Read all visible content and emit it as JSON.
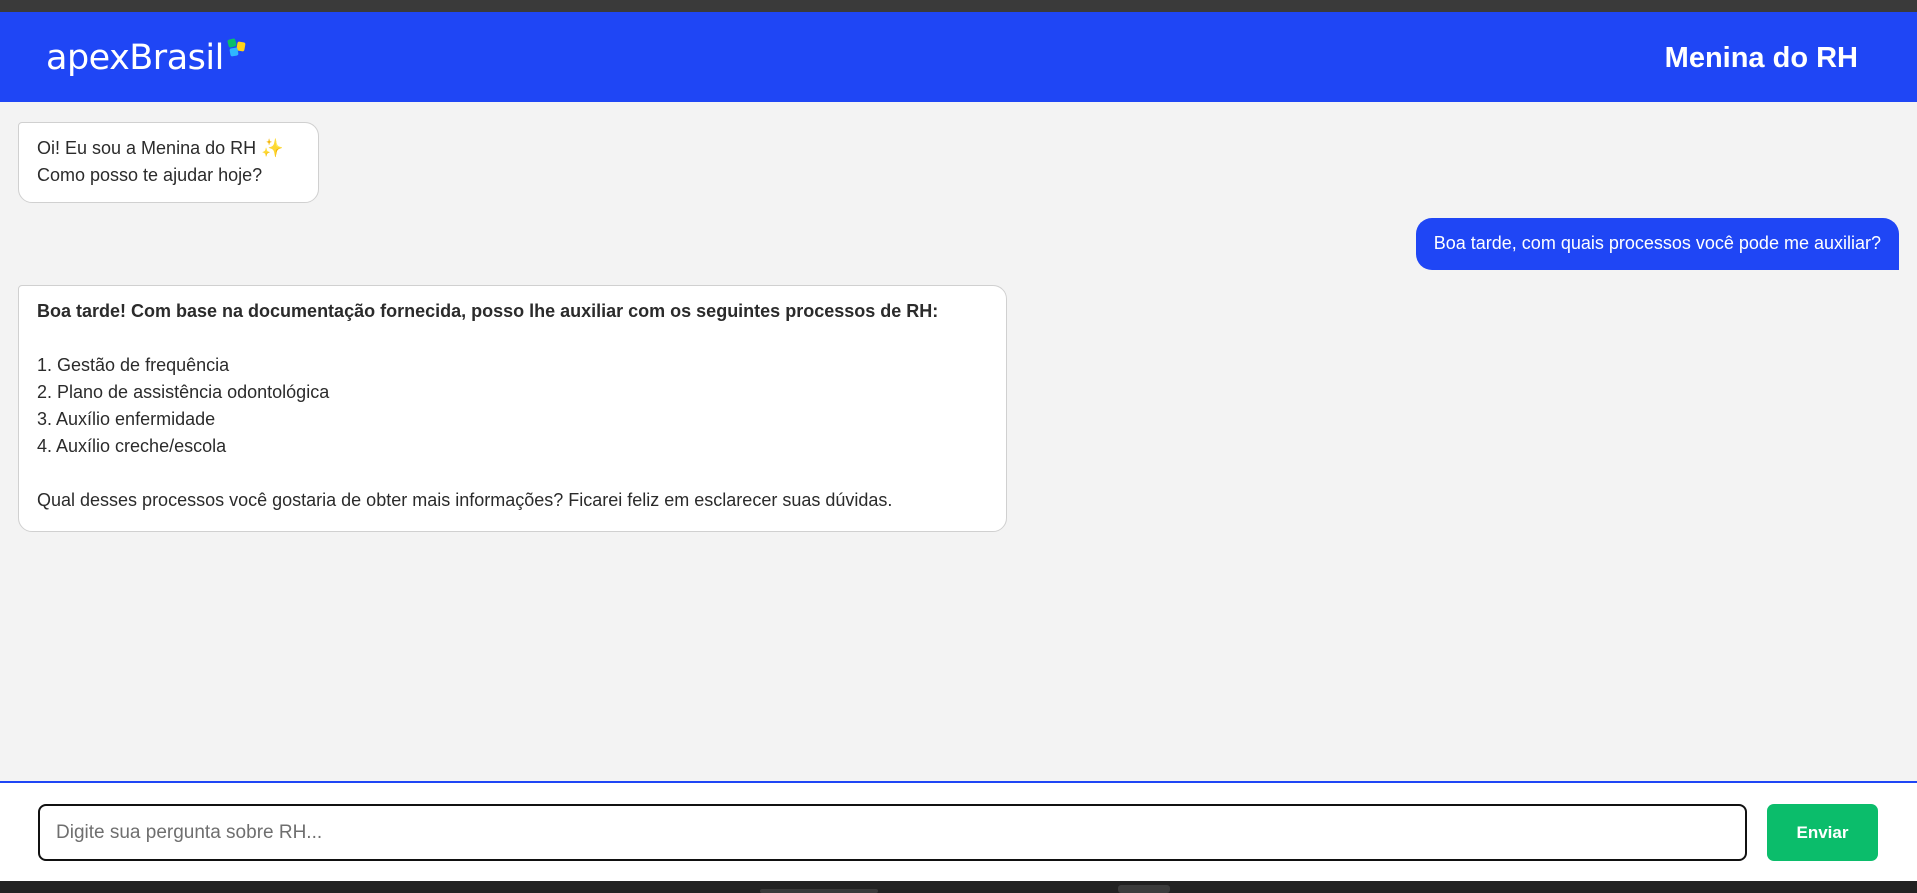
{
  "header": {
    "logo_text": "apexBrasil",
    "title": "Menina do RH",
    "brand_color": "#1f46f5"
  },
  "messages": [
    {
      "role": "bot",
      "lines": [
        "Oi! Eu sou a Menina do RH ✨",
        "Como posso te ajudar hoje?"
      ]
    },
    {
      "role": "user",
      "text": "Boa tarde, com quais processos você pode me auxiliar?"
    },
    {
      "role": "bot",
      "intro": "Boa tarde! Com base na documentação fornecida, posso lhe auxiliar com os seguintes processos de RH:",
      "items": [
        "1. Gestão de frequência",
        "2. Plano de assistência odontológica",
        "3. Auxílio enfermidade",
        "4. Auxílio creche/escola"
      ],
      "outro": "Qual desses processos você gostaria de obter mais informações? Ficarei feliz em esclarecer suas dúvidas."
    }
  ],
  "composer": {
    "placeholder": "Digite sua pergunta sobre RH...",
    "value": "",
    "send_label": "Enviar",
    "send_color": "#0bbd6b"
  }
}
